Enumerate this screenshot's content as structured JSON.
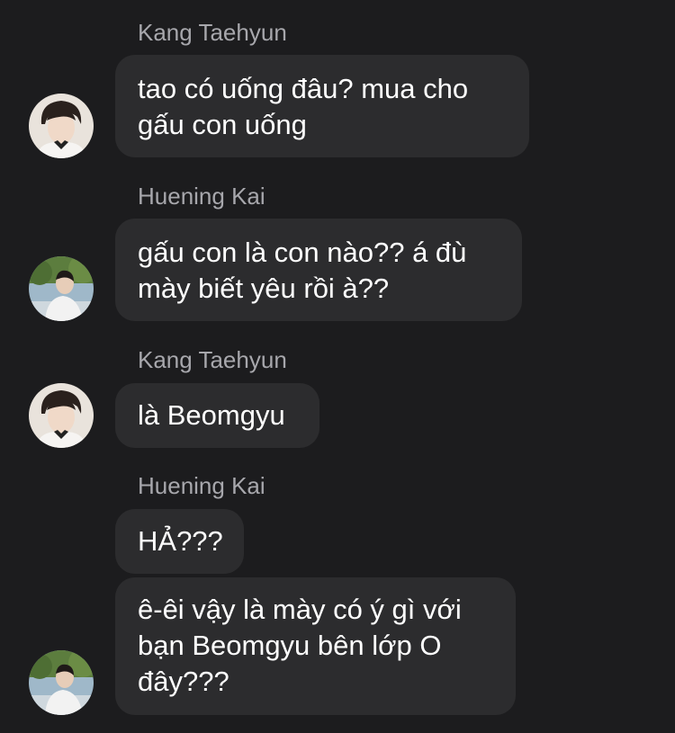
{
  "messages": [
    {
      "sender": "Kang Taehyun",
      "lines": [
        "tao có uống đâu? mua cho",
        "gấu con uống"
      ]
    },
    {
      "sender": "Huening Kai",
      "lines": [
        "gấu con là con nào?? á đù",
        "mày biết yêu rồi à??"
      ]
    },
    {
      "sender": "Kang Taehyun",
      "lines": [
        "là Beomgyu"
      ]
    },
    {
      "sender": "Huening Kai",
      "lines": [
        "HẢ???"
      ]
    },
    {
      "lines": [
        "ê-êi vậy là mày có ý gì với",
        "bạn Beomgyu bên lớp O",
        "đây???"
      ]
    }
  ],
  "avatars": {
    "kang_taehyun": "portrait-avatar",
    "huening_kai": "outdoor-portrait-avatar"
  },
  "colors": {
    "background": "#1c1c1e",
    "bubble": "#2c2c2e",
    "sender_name": "#a7a7ac",
    "message_text": "#ffffff"
  }
}
